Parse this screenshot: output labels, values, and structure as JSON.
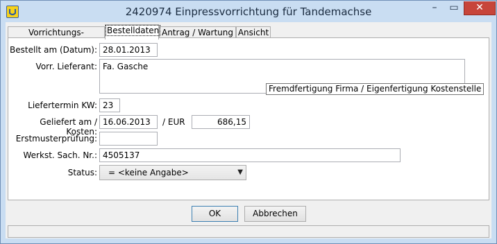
{
  "window": {
    "title": "2420974 Einpressvorrichtung für Tandemachse",
    "minimize": "–",
    "maximize": "▭",
    "close": "✕"
  },
  "tabs": [
    {
      "label": "Vorrichtungs-Basisdaten"
    },
    {
      "label": "Bestelldaten"
    },
    {
      "label": "Antrag / Wartung"
    },
    {
      "label": "Ansicht"
    }
  ],
  "form": {
    "bestellt_label": "Bestellt am (Datum):",
    "bestellt_value": "28.01.2013",
    "lieferant_label": "Vorr. Lieferant:",
    "lieferant_value": "Fa. Gasche",
    "lieferant_tooltip": "Fremdfertigung Firma / Eigenfertigung Kostenstelle",
    "liefertermin_label": "Liefertermin KW:",
    "liefertermin_value": "23",
    "geliefert_label": "Geliefert am / Kosten:",
    "geliefert_value": "16.06.2013",
    "eur_label": "/ EUR",
    "kosten_value": "686,15",
    "erstmuster_label": "Erstmusterprüfung:",
    "erstmuster_value": "",
    "werkst_label": "Werkst. Sach. Nr.:",
    "werkst_value": "4505137",
    "status_label": "Status:",
    "status_value": "= <keine Angabe>"
  },
  "buttons": {
    "ok": "OK",
    "cancel": "Abbrechen"
  }
}
